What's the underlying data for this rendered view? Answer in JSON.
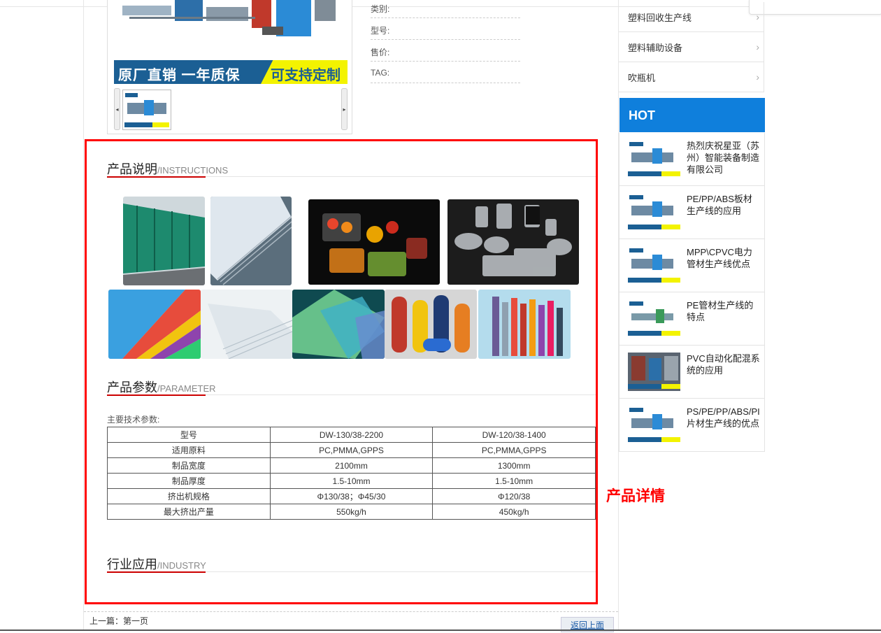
{
  "product_info": {
    "category_label": "类别:",
    "model_label": "型号:",
    "price_label": "售价:",
    "tag_label": "TAG:"
  },
  "banner": {
    "left_text": "原厂直销 一年质保",
    "right_text": "可支持定制"
  },
  "sections": {
    "instructions": {
      "cn": "产品说明",
      "en": "/INSTRUCTIONS"
    },
    "parameter": {
      "cn": "产品参数",
      "en": "/PARAMETER"
    },
    "industry": {
      "cn": "行业应用",
      "en": "/INDUSTRY"
    }
  },
  "params": {
    "caption": "主要技术参数:",
    "rows": [
      [
        "型号",
        "DW-130/38-2200",
        "DW-120/38-1400"
      ],
      [
        "适用原料",
        "PC,PMMA,GPPS",
        "PC,PMMA,GPPS"
      ],
      [
        "制品宽度",
        "2100mm",
        "1300mm"
      ],
      [
        "制品厚度",
        "1.5-10mm",
        "1.5-10mm"
      ],
      [
        "挤出机规格",
        "Φ130/38；Φ45/30",
        "Φ120/38"
      ],
      [
        "最大挤出产量",
        "550kg/h",
        "450kg/h"
      ]
    ]
  },
  "annotation": {
    "label": "产品详情",
    "color": "#ff0000"
  },
  "nav": {
    "prev": "上一篇：第一页",
    "back_top": "返回上面"
  },
  "sidebar": {
    "categories": [
      "塑料回收生产线",
      "塑料辅助设备",
      "吹瓶机"
    ],
    "hot_title": "HOT",
    "hot_items": [
      "热烈庆祝星亚（苏州）智能装备制造有限公司",
      "PE/PP/ABS板材生产线的应用",
      "MPP\\CPVC电力管材生产线优点",
      "PE管材生产线的特点",
      "PVC自动化配混系统的应用",
      "PS/PE/PP/ABS/PI片材生产线的优点"
    ]
  },
  "colors": {
    "accent": "#0f7fdc",
    "frame": "#ff0000",
    "underline": "#cc0000"
  }
}
